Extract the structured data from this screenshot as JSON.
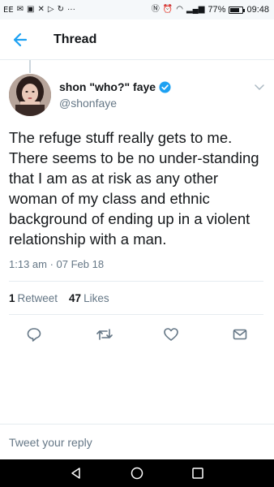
{
  "status_bar": {
    "carrier": "EE",
    "battery": "77%",
    "battery_level": 0.77,
    "time": "09:48"
  },
  "header": {
    "title": "Thread",
    "back_icon": "back-arrow-icon"
  },
  "tweet": {
    "display_name": "shon \"who?\" faye",
    "handle": "@shonfaye",
    "verified": true,
    "text": "The refuge stuff really gets to me. There seems to be no under-standing that I am as at risk as any other woman of my class and ethnic background of ending up in a violent relationship with a man.",
    "timestamp": "1:13 am · 07 Feb 18",
    "retweets_count": "1",
    "retweets_label": "Retweet",
    "likes_count": "47",
    "likes_label": "Likes"
  },
  "reply": {
    "placeholder": "Tweet your reply"
  },
  "colors": {
    "accent": "#1da1f2",
    "text": "#14171a",
    "muted": "#657786",
    "border": "#e6ecf0"
  }
}
